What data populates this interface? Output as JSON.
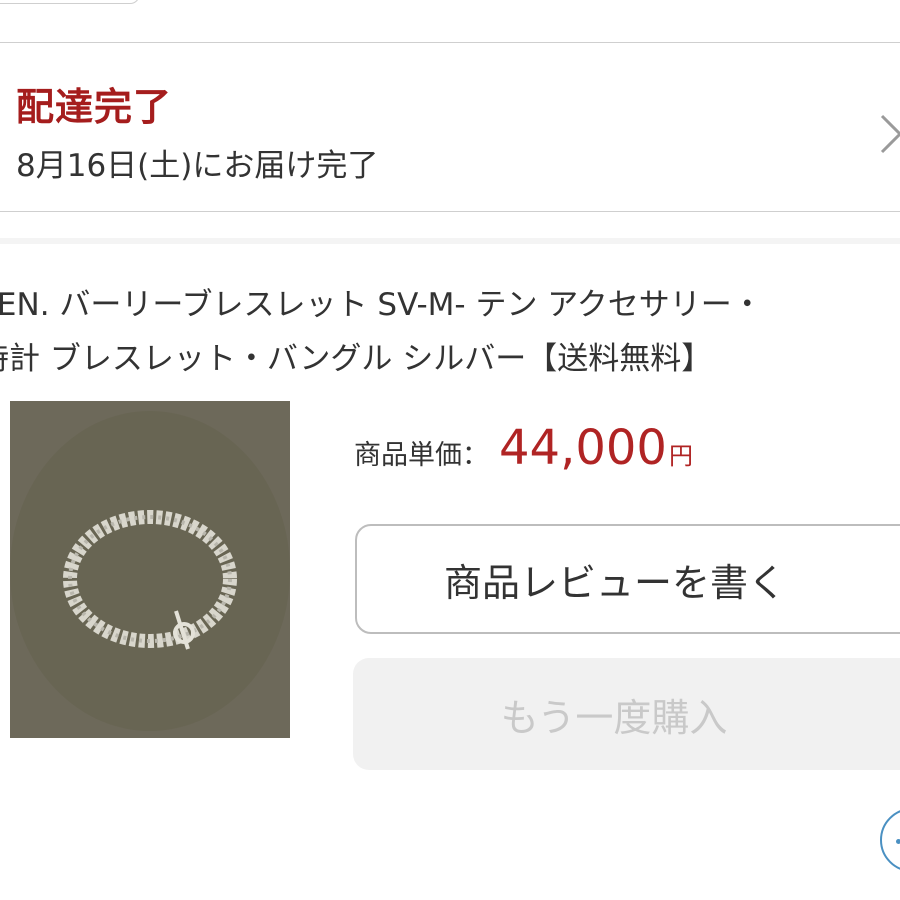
{
  "status": {
    "title": "配達完了",
    "date": "8月16日(土)にお届け完了"
  },
  "product": {
    "title_line1": "TEN. バーリーブレスレット SV-M- テン アクセサリー・",
    "title_line2": "時計 ブレスレット・バングル シルバー【送料無料】",
    "price_label": "商品単価：",
    "price_value": "44,000",
    "price_unit": "円"
  },
  "buttons": {
    "review_label": "商品レビューを書く",
    "rebuy_label": "もう一度購入"
  },
  "colors": {
    "accent_red": "#a51d1d",
    "price_red": "#b02424",
    "disabled_text": "#c9c9c9",
    "disabled_bg": "#f1f1f1"
  },
  "icons": {
    "chevron": "chevron-right-icon",
    "fab": "chat-icon"
  }
}
